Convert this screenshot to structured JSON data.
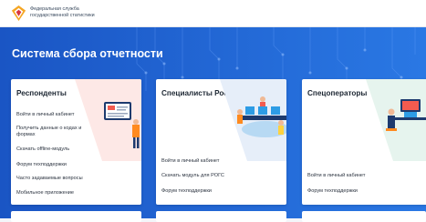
{
  "header": {
    "org_line1": "Федеральная служба",
    "org_line2": "государственной статистики"
  },
  "hero": {
    "title": "Система сбора отчетности"
  },
  "cards": [
    {
      "title": "Респонденты",
      "links": [
        "Войти в личный кабинет",
        "Получить данные о кодах и формах",
        "Скачать offline-модуль",
        "Форум техподдержки",
        "Часто задаваемые вопросы",
        "Мобильное приложение"
      ]
    },
    {
      "title": "Специалисты Росстата",
      "links": [
        "Войти в личный кабинет",
        "Скачать модуль для РОГС",
        "Форум техподдержки"
      ]
    },
    {
      "title": "Спецоператоры",
      "links": [
        "Войти в личный кабинет",
        "Форум техподдержки"
      ]
    }
  ],
  "colors": {
    "hero_blue": "#1b5fd0",
    "card_bg": "#ffffff",
    "accent_orange": "#ff8a1f"
  }
}
